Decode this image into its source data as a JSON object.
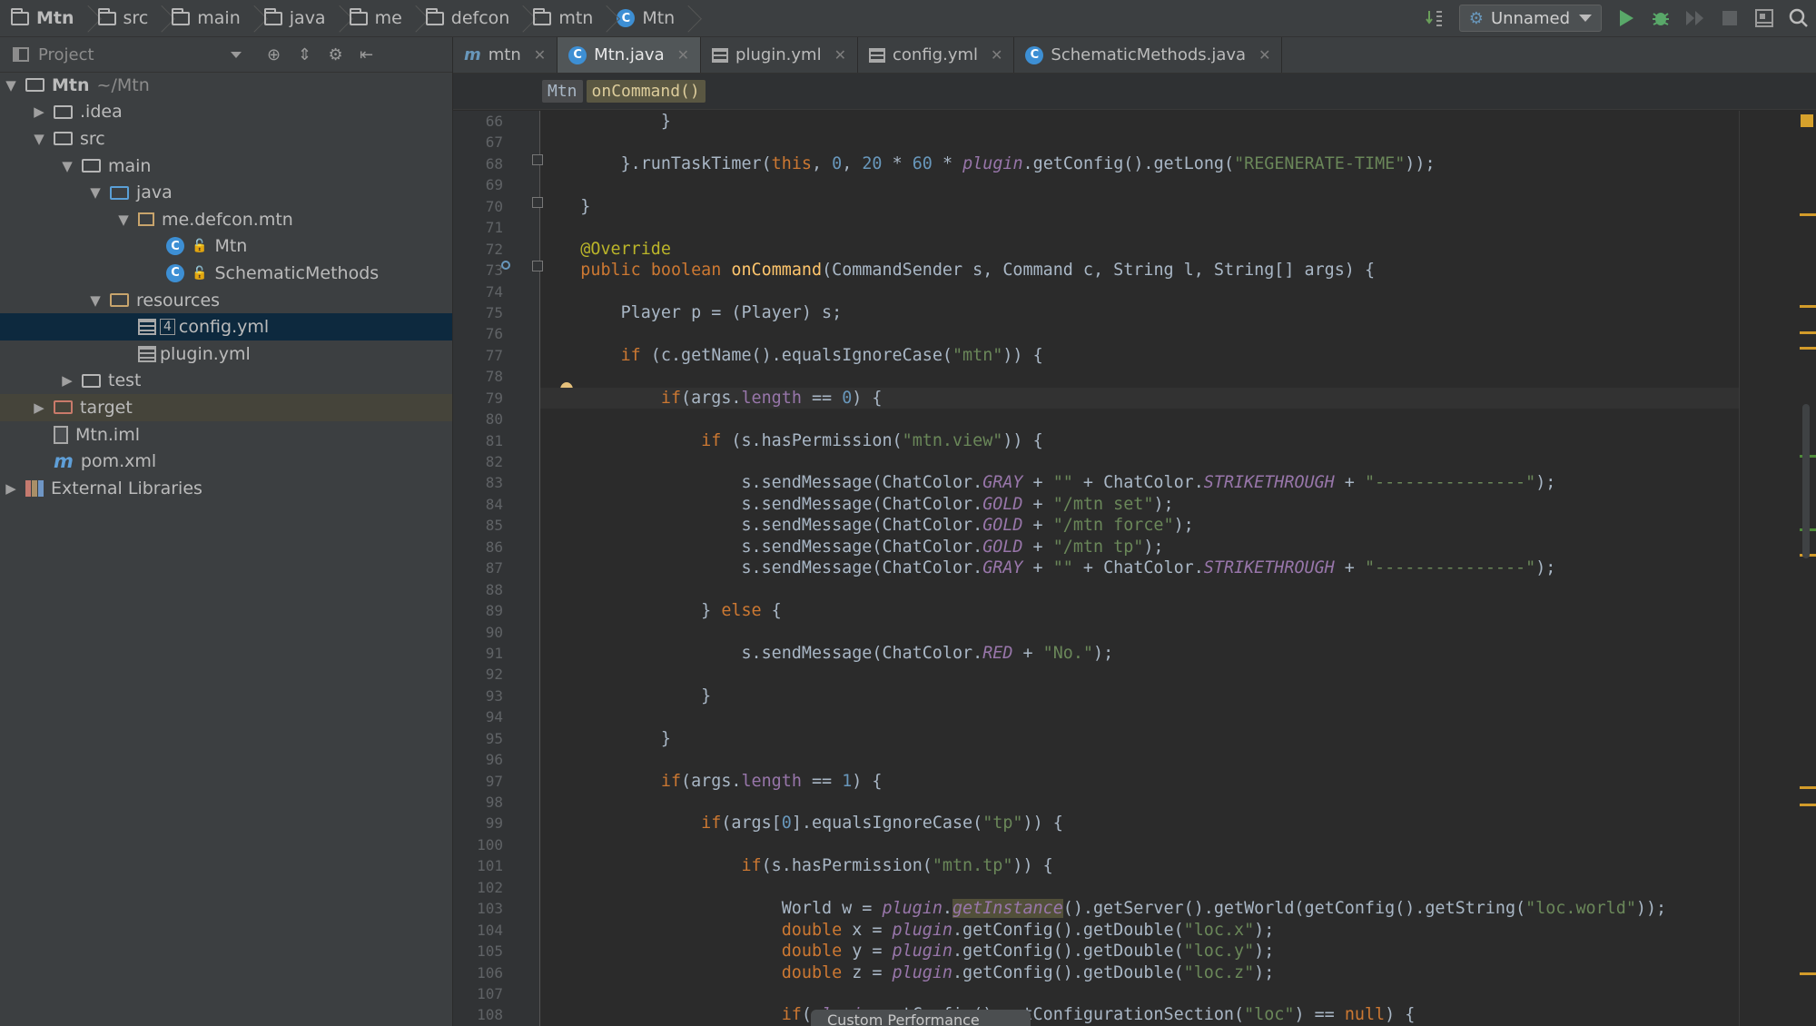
{
  "navbar": {
    "crumbs": [
      {
        "label": "Mtn",
        "icon": "folder-icon"
      },
      {
        "label": "src",
        "icon": "folder-icon"
      },
      {
        "label": "main",
        "icon": "folder-icon"
      },
      {
        "label": "java",
        "icon": "folder-icon"
      },
      {
        "label": "me",
        "icon": "folder-icon"
      },
      {
        "label": "defcon",
        "icon": "folder-icon"
      },
      {
        "label": "mtn",
        "icon": "folder-icon"
      },
      {
        "label": "Mtn",
        "icon": "class-icon"
      }
    ],
    "run_config": "Unnamed"
  },
  "project": {
    "header": "Project",
    "tree": [
      {
        "label": "Mtn",
        "suffix": "~/Mtn"
      },
      {
        "label": ".idea"
      },
      {
        "label": "src"
      },
      {
        "label": "main"
      },
      {
        "label": "java"
      },
      {
        "label": "me.defcon.mtn"
      },
      {
        "label": "Mtn"
      },
      {
        "label": "SchematicMethods"
      },
      {
        "label": "resources"
      },
      {
        "label": "config.yml",
        "badge": "4"
      },
      {
        "label": "plugin.yml"
      },
      {
        "label": "test"
      },
      {
        "label": "target"
      },
      {
        "label": "Mtn.iml"
      },
      {
        "label": "pom.xml"
      },
      {
        "label": "External Libraries"
      }
    ]
  },
  "tabs": [
    {
      "label": "mtn",
      "active": false
    },
    {
      "label": "Mtn.java",
      "active": true
    },
    {
      "label": "plugin.yml",
      "active": false
    },
    {
      "label": "config.yml",
      "active": false
    },
    {
      "label": "SchematicMethods.java",
      "active": false
    }
  ],
  "editor_breadcrumbs": [
    "Mtn",
    "onCommand()"
  ],
  "popup_text": "Custom Performance",
  "line_numbers": [
    "66",
    "67",
    "68",
    "69",
    "70",
    "71",
    "72",
    "73",
    "74",
    "75",
    "76",
    "77",
    "78",
    "79",
    "80",
    "81",
    "82",
    "83",
    "84",
    "85",
    "86",
    "87",
    "88",
    "89",
    "90",
    "91",
    "92",
    "93",
    "94",
    "95",
    "96",
    "97",
    "98",
    "99",
    "100",
    "101",
    "102",
    "103",
    "104",
    "105",
    "106",
    "107",
    "108"
  ],
  "code_lines": [
    "            }",
    "",
    "        }.runTaskTimer(this, 0, 20 * 60 * plugin.getConfig().getLong(\"REGENERATE-TIME\"));",
    "",
    "    }",
    "",
    "    @Override",
    "    public boolean onCommand(CommandSender s, Command c, String l, String[] args) {",
    "",
    "        Player p = (Player) s;",
    "",
    "        if (c.getName().equalsIgnoreCase(\"mtn\")) {",
    "",
    "            if(args.length == 0) {",
    "",
    "                if (s.hasPermission(\"mtn.view\")) {",
    "",
    "                    s.sendMessage(ChatColor.GRAY + \"\" + ChatColor.STRIKETHROUGH + \"---------------\");",
    "                    s.sendMessage(ChatColor.GOLD + \"/mtn set\");",
    "                    s.sendMessage(ChatColor.GOLD + \"/mtn force\");",
    "                    s.sendMessage(ChatColor.GOLD + \"/mtn tp\");",
    "                    s.sendMessage(ChatColor.GRAY + \"\" + ChatColor.STRIKETHROUGH + \"---------------\");",
    "",
    "                } else {",
    "",
    "                    s.sendMessage(ChatColor.RED + \"No.\");",
    "",
    "                }",
    "",
    "            }",
    "",
    "            if(args.length == 1) {",
    "",
    "                if(args[0].equalsIgnoreCase(\"tp\")) {",
    "",
    "                    if(s.hasPermission(\"mtn.tp\")) {",
    "",
    "                        World w = plugin.getInstance().getServer().getWorld(getConfig().getString(\"loc.world\"));",
    "                        double x = plugin.getConfig().getDouble(\"loc.x\");",
    "                        double y = plugin.getConfig().getDouble(\"loc.y\");",
    "                        double z = plugin.getConfig().getDouble(\"loc.z\");",
    "",
    "                        if(plugin.getConfig().getConfigurationSection(\"loc\") == null) {"
  ],
  "colors": {
    "background": "#2b2b2b",
    "keyword": "#cc7832",
    "string": "#6a8759",
    "number": "#6897bb",
    "annotation": "#bbb529",
    "field": "#9876aa",
    "method": "#ffc66d",
    "selection": "#0d293e"
  }
}
